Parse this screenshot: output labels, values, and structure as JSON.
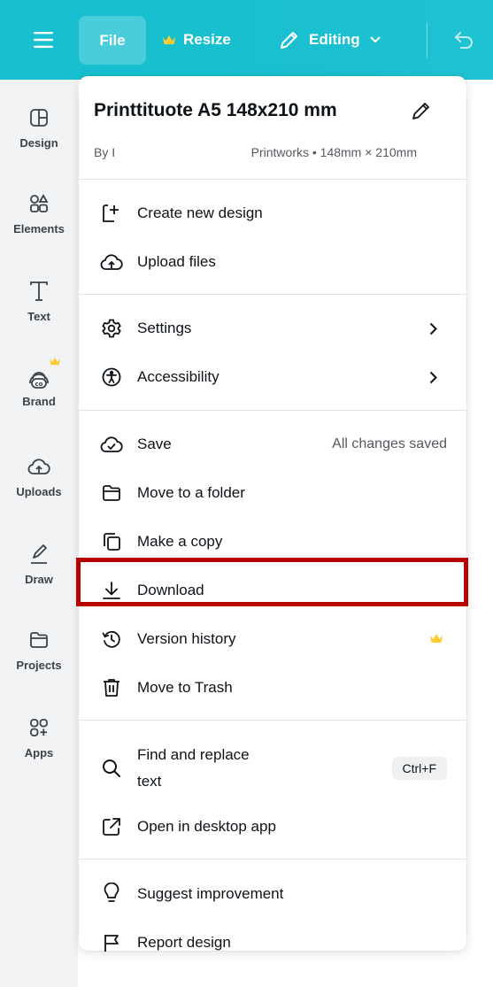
{
  "topbar": {
    "menu_icon": "hamburger-icon",
    "file_label": "File",
    "resize_label": "Resize",
    "editing_label": "Editing",
    "undo_icon": "undo-icon",
    "crown_color": "#ffcc33",
    "background": "#18bfcf"
  },
  "sidebar": {
    "items": [
      {
        "label": "Design",
        "icon": "layout-icon"
      },
      {
        "label": "Elements",
        "icon": "shapes-icon"
      },
      {
        "label": "Text",
        "icon": "text-icon"
      },
      {
        "label": "Brand",
        "icon": "brand-icon"
      },
      {
        "label": "Uploads",
        "icon": "cloud-upload-icon"
      },
      {
        "label": "Draw",
        "icon": "pen-icon"
      },
      {
        "label": "Projects",
        "icon": "folder-icon"
      },
      {
        "label": "Apps",
        "icon": "apps-icon"
      }
    ]
  },
  "menu": {
    "title": "Printtituote A5 148x210 mm",
    "by": "By I",
    "meta": "Printworks • 148mm × 210mm",
    "create_new": "Create new design",
    "upload_files": "Upload files",
    "settings": "Settings",
    "accessibility": "Accessibility",
    "save": "Save",
    "save_status": "All changes saved",
    "move_folder": "Move to a folder",
    "make_copy": "Make a copy",
    "download": "Download",
    "version_history": "Version history",
    "move_trash": "Move to Trash",
    "find_replace_line1": "Find and replace",
    "find_replace_line2": "text",
    "find_replace_shortcut": "Ctrl+F",
    "open_desktop": "Open in desktop app",
    "suggest": "Suggest improvement",
    "report": "Report design"
  },
  "highlight_color": "#b80000"
}
